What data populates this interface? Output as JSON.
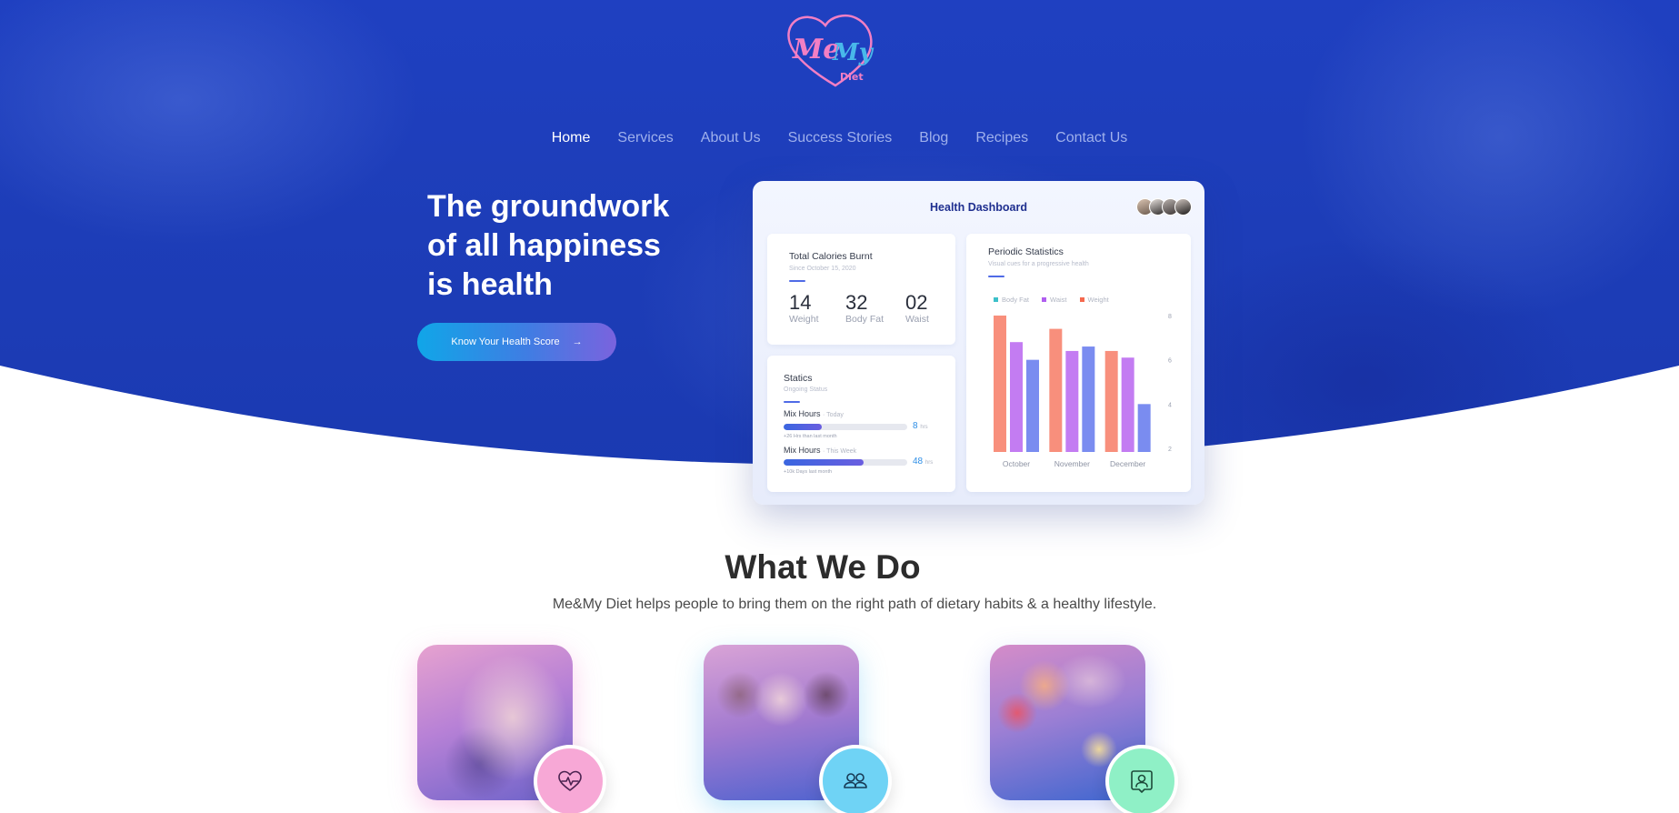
{
  "brand": {
    "logo_text_1": "Me",
    "logo_text_2": "My",
    "logo_text_3": "Diet",
    "colors": {
      "primary": "#1f40c1",
      "pink": "#f27fc4",
      "cyan": "#48b8ea"
    }
  },
  "nav": {
    "items": [
      {
        "label": "Home",
        "active": true
      },
      {
        "label": "Services",
        "active": false
      },
      {
        "label": "About Us",
        "active": false
      },
      {
        "label": "Success Stories",
        "active": false
      },
      {
        "label": "Blog",
        "active": false
      },
      {
        "label": "Recipes",
        "active": false
      },
      {
        "label": "Contact Us",
        "active": false
      }
    ]
  },
  "hero": {
    "headline_line1": "The groundwork",
    "headline_line2": "of all happiness",
    "headline_line3": "is health",
    "cta_label": "Know Your Health Score",
    "cta_arrow": "→"
  },
  "dashboard": {
    "title": "Health Dashboard",
    "calories": {
      "title": "Total Calories Burnt",
      "subtitle": "Since October 15, 2020",
      "metrics": [
        {
          "value": "14",
          "label": "Weight"
        },
        {
          "value": "32",
          "label": "Body Fat"
        },
        {
          "value": "02",
          "label": "Waist"
        }
      ]
    },
    "statics": {
      "title": "Statics",
      "subtitle": "Ongoing Status",
      "rows": [
        {
          "label": "Mix Hours",
          "period": "· Today",
          "value": "8",
          "unit": "hrs",
          "note": "+26 Hrs than last month",
          "progress": 0.31
        },
        {
          "label": "Mix Hours",
          "period": "· This Week",
          "value": "48",
          "unit": "hrs",
          "note": "+10k Days last month",
          "progress": 0.65
        }
      ]
    },
    "periodic": {
      "title": "Periodic Statistics",
      "subtitle": "Visual cues for a progressive health"
    }
  },
  "chart_data": {
    "type": "bar",
    "categories": [
      "October",
      "November",
      "December"
    ],
    "series": [
      {
        "name": "Body Fat",
        "values": [
          8.0,
          7.4,
          6.4
        ],
        "color": "#f88f7c"
      },
      {
        "name": "Waist",
        "values": [
          6.8,
          6.4,
          6.1
        ],
        "color": "#c37cf2"
      },
      {
        "name": "Weight",
        "values": [
          6.0,
          6.6,
          4.0
        ],
        "color": "#7a8cf0"
      }
    ],
    "ylim": [
      2,
      8
    ],
    "yticks": [
      "2",
      "4",
      "6",
      "8"
    ],
    "legend_position": "top-left",
    "grid": false
  },
  "what_we_do": {
    "title": "What We Do",
    "subtitle": "Me&My Diet helps people to bring them on the right path of dietary habits & a healthy lifestyle.",
    "features": [
      {
        "icon": "heart-pulse-icon",
        "badge_color": "#f7a8d6"
      },
      {
        "icon": "users-icon",
        "badge_color": "#6fd3f5"
      },
      {
        "icon": "user-chat-icon",
        "badge_color": "#8ff0c6"
      }
    ]
  }
}
